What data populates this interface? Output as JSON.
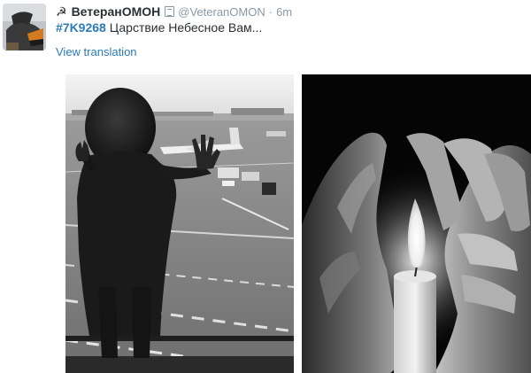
{
  "tweet": {
    "display_name": "ВетеранОМОН",
    "handle": "@VeteranOMON",
    "separator": "·",
    "time": "6m",
    "hashtag": "#7K9268",
    "text": " Царствие Небесное Вам...",
    "view_translation": "View translation"
  },
  "icons": {
    "name_prefix": "sickle-hammer-icon",
    "verified_like": "document-badge-icon"
  },
  "colors": {
    "link": "#2b7bb9",
    "name": "#292f33",
    "muted": "#8899a6"
  },
  "media": [
    {
      "name": "child-at-airport-window-photo"
    },
    {
      "name": "hands-around-candle-photo"
    }
  ]
}
